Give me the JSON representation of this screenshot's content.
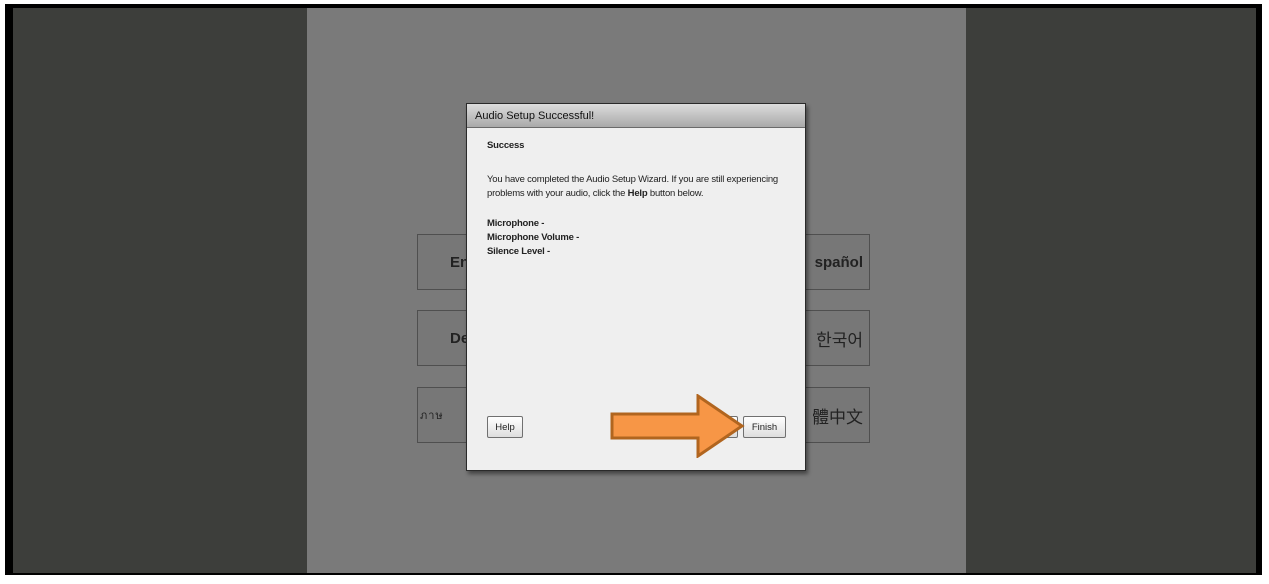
{
  "languages": {
    "left": [
      "Eng",
      "Deu",
      "ภาษ"
    ],
    "right": [
      "spañol",
      "한국어",
      "體中文"
    ]
  },
  "dialog": {
    "title": "Audio Setup Successful!",
    "heading": "Success",
    "message_part1": "You have completed the Audio Setup Wizard. If you are still experiencing problems with your audio, click the ",
    "message_bold": "Help",
    "message_part2": " button below.",
    "stats": [
      "Microphone -",
      "Microphone Volume -",
      "Silence Level -"
    ],
    "buttons": {
      "help": "Help",
      "prev": "ev",
      "finish": "Finish"
    }
  },
  "colors": {
    "arrow_fill": "#f79646",
    "arrow_stroke": "#b1651f",
    "side_panels": "#3d3e3b",
    "center_overlay": "#7a7a7a"
  }
}
